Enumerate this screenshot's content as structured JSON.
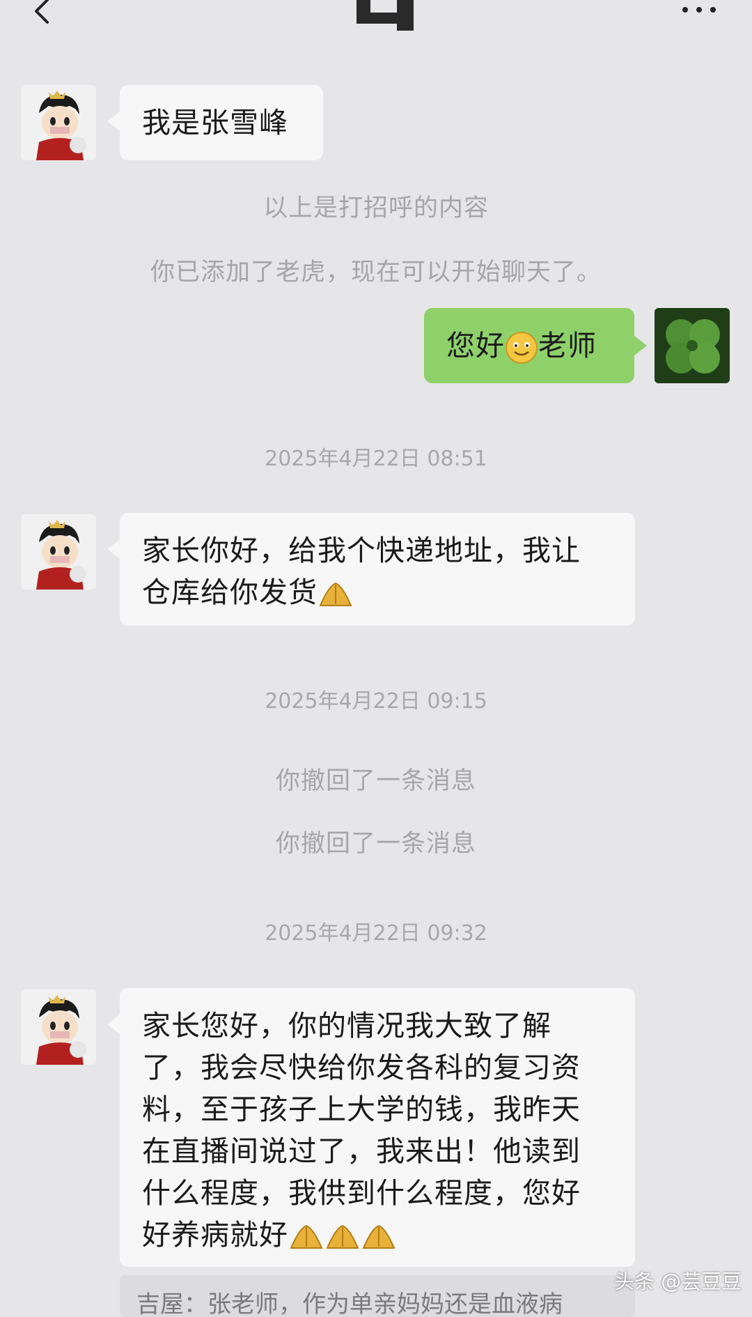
{
  "header": {
    "back_icon": "chevron-left-icon",
    "more_icon": "more-dots-icon"
  },
  "messages": {
    "m1": "我是张雪峰",
    "sys1": "以上是打招呼的内容",
    "sys2": "你已添加了老虎，现在可以开始聊天了。",
    "m2_pre": "您好",
    "m2_post": "老师",
    "t1": "2025年4月22日 08:51",
    "m3_line1": "家长你好，给我个快递地址，我让",
    "m3_line2": "仓库给你发货",
    "t2": "2025年4月22日 09:15",
    "sys3": "你撤回了一条消息",
    "sys4": "你撤回了一条消息",
    "t3": "2025年4月22日 09:32",
    "m4_lines": [
      "家长您好，你的情况我大致了解",
      "了，我会尽快给你发各科的复习资",
      "料，至于孩子上大学的钱，我昨天",
      "在直播间说过了，我来出！他读到",
      "什么程度，我供到什么程度，您好",
      "好养病就好"
    ],
    "quote": "吉屋：张老师，作为单亲妈妈还是血液病"
  },
  "watermark": "头条 @芸豆豆",
  "colors": {
    "background": "#e6e6e8",
    "left_bubble": "#f7f7f8",
    "right_bubble": "#8ed16a"
  }
}
